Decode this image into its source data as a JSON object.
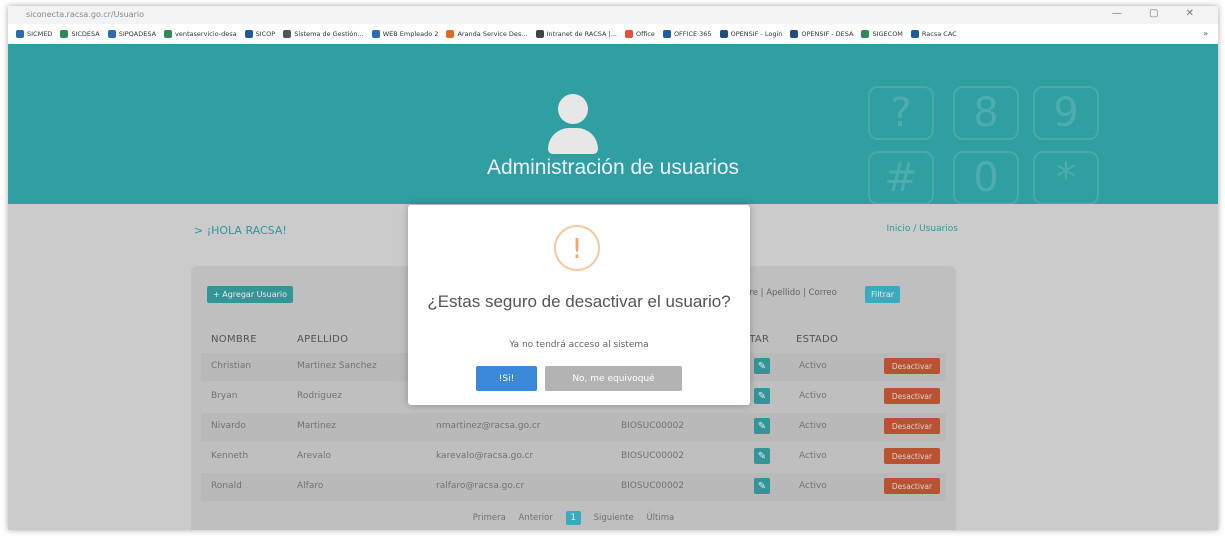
{
  "browser": {
    "url": "siconecta.racsa.go.cr/Usuario",
    "bookmarks": [
      {
        "label": "SICMED",
        "color": "#2b6cb0"
      },
      {
        "label": "SICDESA",
        "color": "#2e8b57"
      },
      {
        "label": "SIPQADESA",
        "color": "#2b6cb0"
      },
      {
        "label": "ventaservicio-desa",
        "color": "#2e8b57"
      },
      {
        "label": "SICOP",
        "color": "#1a5c9a"
      },
      {
        "label": "Sistema de Gestión...",
        "color": "#555555"
      },
      {
        "label": "WEB Empleado 2",
        "color": "#2b6cb0"
      },
      {
        "label": "Aranda Service Des...",
        "color": "#e66a1e"
      },
      {
        "label": "Intranet de RACSA |...",
        "color": "#444444"
      },
      {
        "label": "Office",
        "color": "#e74c3c"
      },
      {
        "label": "OFFICE 365",
        "color": "#1e5aa8"
      },
      {
        "label": "OPENSIF - Login",
        "color": "#1f4f7a"
      },
      {
        "label": "OPENSIF - DESA",
        "color": "#1f4f7a"
      },
      {
        "label": "SIGECOM",
        "color": "#2e8b57"
      },
      {
        "label": "Racsa CAC",
        "color": "#1a5c9a"
      }
    ],
    "more": "»"
  },
  "hero": {
    "title": "Administración de usuarios"
  },
  "page": {
    "greeting": "> ¡HOLA RACSA!",
    "breadcrumb": "Inicio / Usuarios",
    "add_button": "+ Agregar Usuario",
    "filter_hint": "bre | Apellido | Correo",
    "filter_button": "Filtrar"
  },
  "table": {
    "headers": {
      "nombre": "NOMBRE",
      "apellido": "APELLIDO",
      "editar": "ITAR",
      "estado": "ESTADO"
    },
    "rows": [
      {
        "nombre": "Christian",
        "apellido": "Martinez Sanchez",
        "correo": "",
        "codigo": "",
        "estado": "Activo",
        "accion": "Desactivar"
      },
      {
        "nombre": "Bryan",
        "apellido": "Rodriguez",
        "correo": "",
        "codigo": "",
        "estado": "Activo",
        "accion": "Desactivar"
      },
      {
        "nombre": "Nivardo",
        "apellido": "Martinez",
        "correo": "nmartinez@racsa.go.cr",
        "codigo": "BIOSUC00002",
        "estado": "Activo",
        "accion": "Desactivar"
      },
      {
        "nombre": "Kenneth",
        "apellido": "Arevalo",
        "correo": "karevalo@racsa.go.cr",
        "codigo": "BIOSUC00002",
        "estado": "Activo",
        "accion": "Desactivar"
      },
      {
        "nombre": "Ronald",
        "apellido": "Alfaro",
        "correo": "ralfaro@racsa.go.cr",
        "codigo": "BIOSUC00002",
        "estado": "Activo",
        "accion": "Desactivar"
      }
    ]
  },
  "pagination": {
    "first": "Primera",
    "prev": "Anterior",
    "current": "1",
    "next": "Siguiente",
    "last": "Última"
  },
  "modal": {
    "icon": "!",
    "title": "¿Estas seguro de desactivar el usuario?",
    "text": "Ya no tendrá acceso al sistema",
    "confirm": "!Si!",
    "cancel": "No, me equivoqué"
  },
  "keypad": [
    "?",
    "8",
    "9",
    "#",
    "0",
    "*"
  ]
}
